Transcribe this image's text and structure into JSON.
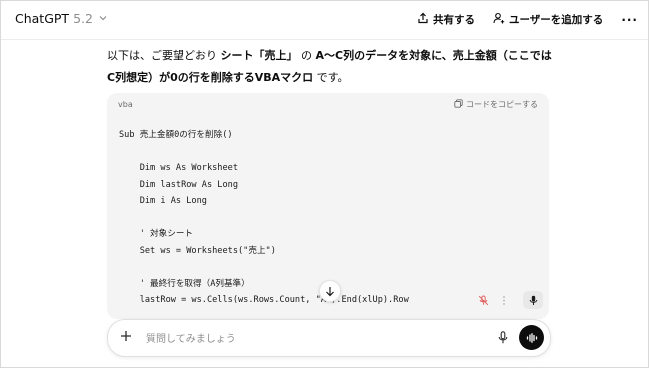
{
  "header": {
    "model_name": "ChatGPT",
    "model_version": "5.2",
    "share_label": "共有する",
    "add_user_label": "ユーザーを追加する",
    "more_label": "···"
  },
  "message": {
    "part1": "以下は、ご要望どおり ",
    "part2": "シート「売上」",
    "part3": " の ",
    "part4": "A〜C列のデータを対象に、売上金額（ここではC列想定）が0の行を削除するVBAマクロ",
    "part5": " です。"
  },
  "code_block": {
    "language": "vba",
    "copy_label": "コードをコピーする",
    "lines": [
      "Sub 売上金額0の行を削除()",
      "",
      "    Dim ws As Worksheet",
      "    Dim lastRow As Long",
      "    Dim i As Long",
      "",
      "    ' 対象シート",
      "    Set ws = Worksheets(\"売上\")",
      "",
      "    ' 最終行を取得（A列基準）",
      "    lastRow = ws.Cells(ws.Rows.Count, \"A\").End(xlUp).Row"
    ]
  },
  "composer": {
    "placeholder": "質問してみましょう",
    "value": ""
  }
}
